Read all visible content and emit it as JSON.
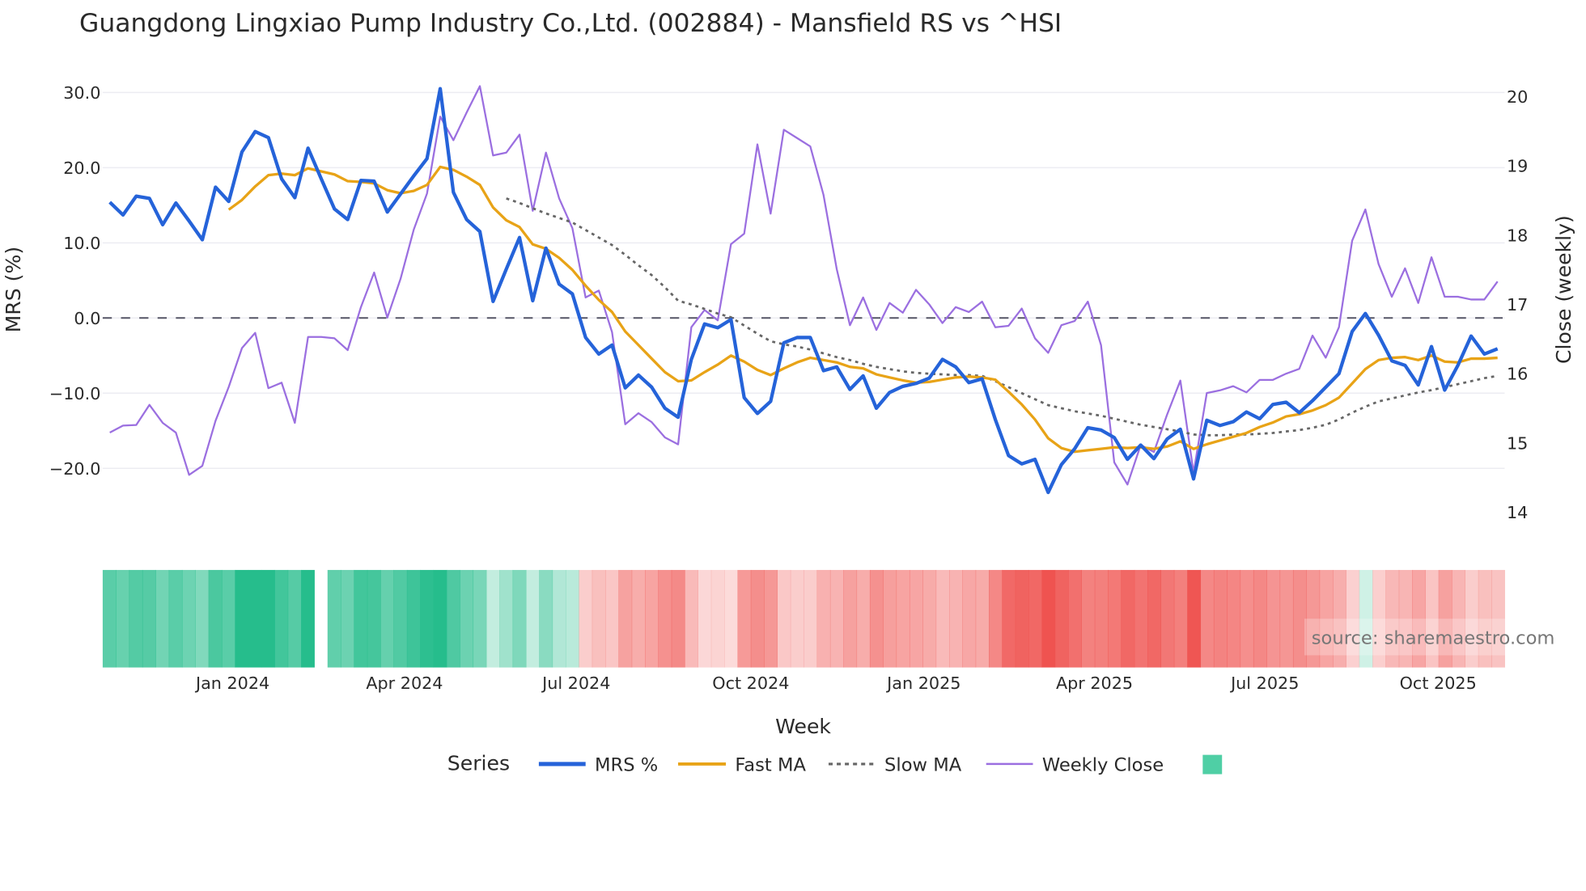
{
  "chart_data": {
    "type": "line",
    "title": "Guangdong Lingxiao Pump Industry Co.,Ltd. (002884) - Mansfield RS vs ^HSI",
    "xlabel": "Week",
    "ylabel": "MRS (%)",
    "y2label": "Close (weekly)",
    "ylim": [
      -28.5,
      32
    ],
    "y2lim": [
      13.6,
      20.4
    ],
    "yticks": [
      "30.0",
      "20.0",
      "10.0",
      "0.0",
      "−10.0",
      "−20.0"
    ],
    "ytick_values": [
      30,
      20,
      10,
      0,
      -10,
      -20
    ],
    "y2ticks": [
      "20",
      "19",
      "18",
      "17",
      "16",
      "15",
      "14"
    ],
    "y2tick_values": [
      20,
      19,
      18,
      17,
      16,
      15,
      14
    ],
    "xticks": [
      "Jan 2024",
      "Apr 2024",
      "Jul 2024",
      "Oct 2024",
      "Jan 2025",
      "Apr 2025",
      "Jul 2025",
      "Oct 2025"
    ],
    "xtick_week_index": [
      9.3,
      22.3,
      35.3,
      48.5,
      61.6,
      74.5,
      87.4,
      100.5
    ],
    "zero_line": 0,
    "legend_title": "Series",
    "legend_position": "bottom",
    "source": "source: sharemaestro.com",
    "colors": {
      "mrs": "#2563d9",
      "fast": "#e8a317",
      "slow": "#666666",
      "close": "#9b6fe0",
      "pos": "#26bd8c",
      "neg": "#ef5350",
      "zero": "#555566"
    },
    "series": [
      {
        "name": "MRS %",
        "key": "mrs",
        "values": [
          15.4,
          13.7,
          16.2,
          15.9,
          12.4,
          15.3,
          12.9,
          10.4,
          17.4,
          15.5,
          22.1,
          24.8,
          24.0,
          18.5,
          16.0,
          22.6,
          18.5,
          14.5,
          13.1,
          18.3,
          18.2,
          14.1,
          16.5,
          18.9,
          21.2,
          30.5,
          16.7,
          13.1,
          11.5,
          2.2,
          6.5,
          10.7,
          2.3,
          9.3,
          4.5,
          3.2,
          -2.6,
          -4.8,
          -3.6,
          -9.3,
          -7.6,
          -9.2,
          -12.0,
          -13.2,
          -5.5,
          -0.8,
          -1.3,
          -0.2,
          -10.6,
          -12.7,
          -11.1,
          -3.3,
          -2.6,
          -2.6,
          -7.0,
          -6.5,
          -9.5,
          -7.7,
          -12.0,
          -9.9,
          -9.1,
          -8.7,
          -8.0,
          -5.5,
          -6.5,
          -8.6,
          -8.1,
          -13.5,
          -18.3,
          -19.4,
          -18.8,
          -23.2,
          -19.5,
          -17.4,
          -14.6,
          -14.9,
          -15.9,
          -18.8,
          -16.9,
          -18.7,
          -16.1,
          -14.8,
          -21.4,
          -13.6,
          -14.3,
          -13.8,
          -12.5,
          -13.4,
          -11.5,
          -11.2,
          -12.6,
          -11.0,
          -9.2,
          -7.4,
          -1.8,
          0.6,
          -2.3,
          -5.7,
          -6.3,
          -8.9,
          -3.8,
          -9.6,
          -6.3,
          -2.4,
          -4.8,
          -4.1
        ]
      },
      {
        "name": "Fast MA",
        "key": "fast",
        "values": [
          null,
          null,
          null,
          null,
          null,
          null,
          null,
          null,
          null,
          14.4,
          15.7,
          17.5,
          19.0,
          19.2,
          19.0,
          19.9,
          19.5,
          19.1,
          18.2,
          18.1,
          17.9,
          17.0,
          16.6,
          16.9,
          17.7,
          20.1,
          19.7,
          18.8,
          17.7,
          14.7,
          13.0,
          12.1,
          9.8,
          9.2,
          8.0,
          6.4,
          4.3,
          2.4,
          0.8,
          -1.8,
          -3.6,
          -5.4,
          -7.2,
          -8.4,
          -8.3,
          -7.2,
          -6.2,
          -5.0,
          -5.8,
          -6.9,
          -7.6,
          -6.7,
          -5.9,
          -5.3,
          -5.6,
          -5.9,
          -6.5,
          -6.7,
          -7.5,
          -7.9,
          -8.3,
          -8.6,
          -8.5,
          -8.2,
          -7.9,
          -7.8,
          -7.9,
          -8.2,
          -9.8,
          -11.5,
          -13.5,
          -16.0,
          -17.3,
          -17.8,
          -17.6,
          -17.4,
          -17.2,
          -17.3,
          -17.2,
          -17.4,
          -17.1,
          -16.4,
          -17.4,
          -16.8,
          -16.3,
          -15.8,
          -15.3,
          -14.5,
          -13.9,
          -13.1,
          -12.8,
          -12.3,
          -11.6,
          -10.6,
          -8.7,
          -6.8,
          -5.6,
          -5.3,
          -5.2,
          -5.6,
          -5.0,
          -5.8,
          -5.9,
          -5.4,
          -5.4,
          -5.3
        ]
      },
      {
        "name": "Slow MA",
        "key": "slow",
        "values": [
          null,
          null,
          null,
          null,
          null,
          null,
          null,
          null,
          null,
          null,
          null,
          null,
          null,
          null,
          null,
          null,
          null,
          null,
          null,
          null,
          null,
          null,
          null,
          null,
          null,
          null,
          null,
          null,
          null,
          null,
          15.9,
          15.3,
          14.6,
          13.9,
          13.3,
          12.7,
          11.7,
          10.7,
          9.7,
          8.4,
          7.0,
          5.7,
          4.1,
          2.3,
          1.8,
          1.2,
          0.6,
          0.1,
          -1.0,
          -2.1,
          -3.1,
          -3.5,
          -3.8,
          -4.2,
          -4.7,
          -5.2,
          -5.6,
          -6.1,
          -6.5,
          -6.8,
          -7.1,
          -7.3,
          -7.4,
          -7.5,
          -7.6,
          -7.6,
          -7.7,
          -8.4,
          -9.2,
          -10.0,
          -10.8,
          -11.6,
          -12.0,
          -12.4,
          -12.7,
          -13.0,
          -13.4,
          -13.8,
          -14.2,
          -14.5,
          -14.8,
          -15.1,
          -15.5,
          -15.6,
          -15.6,
          -15.5,
          -15.5,
          -15.4,
          -15.3,
          -15.1,
          -14.9,
          -14.6,
          -14.2,
          -13.5,
          -12.6,
          -11.8,
          -11.1,
          -10.7,
          -10.3,
          -9.9,
          -9.6,
          -9.2,
          -8.8,
          -8.4,
          -8.0,
          -7.7
        ]
      },
      {
        "name": "Weekly Close",
        "key": "close",
        "axis": "right",
        "values": [
          15.15,
          15.25,
          15.26,
          15.55,
          15.29,
          15.15,
          14.54,
          14.67,
          15.32,
          15.81,
          16.37,
          16.59,
          15.79,
          15.87,
          15.29,
          16.53,
          16.53,
          16.51,
          16.34,
          16.96,
          17.46,
          16.81,
          17.37,
          18.08,
          18.6,
          19.71,
          19.37,
          19.77,
          20.15,
          19.15,
          19.19,
          19.45,
          18.35,
          19.19,
          18.53,
          18.1,
          17.1,
          17.2,
          16.6,
          15.27,
          15.43,
          15.3,
          15.08,
          14.98,
          16.67,
          16.92,
          16.77,
          17.87,
          18.02,
          19.31,
          18.31,
          19.52,
          19.4,
          19.28,
          18.58,
          17.51,
          16.7,
          17.1,
          16.63,
          17.02,
          16.88,
          17.21,
          17.0,
          16.73,
          16.96,
          16.89,
          17.04,
          16.67,
          16.69,
          16.94,
          16.51,
          16.3,
          16.7,
          16.76,
          17.04,
          16.41,
          14.72,
          14.4,
          14.97,
          14.87,
          15.41,
          15.9,
          14.57,
          15.72,
          15.76,
          15.82,
          15.73,
          15.91,
          15.91,
          16.0,
          16.07,
          16.55,
          16.23,
          16.67,
          17.92,
          18.37,
          17.58,
          17.11,
          17.52,
          17.02,
          17.68,
          17.11,
          17.11,
          17.07,
          17.07,
          17.33
        ]
      }
    ],
    "heatmap": {
      "based_on": "MRS %",
      "missing_week_index": [
        16
      ]
    }
  }
}
